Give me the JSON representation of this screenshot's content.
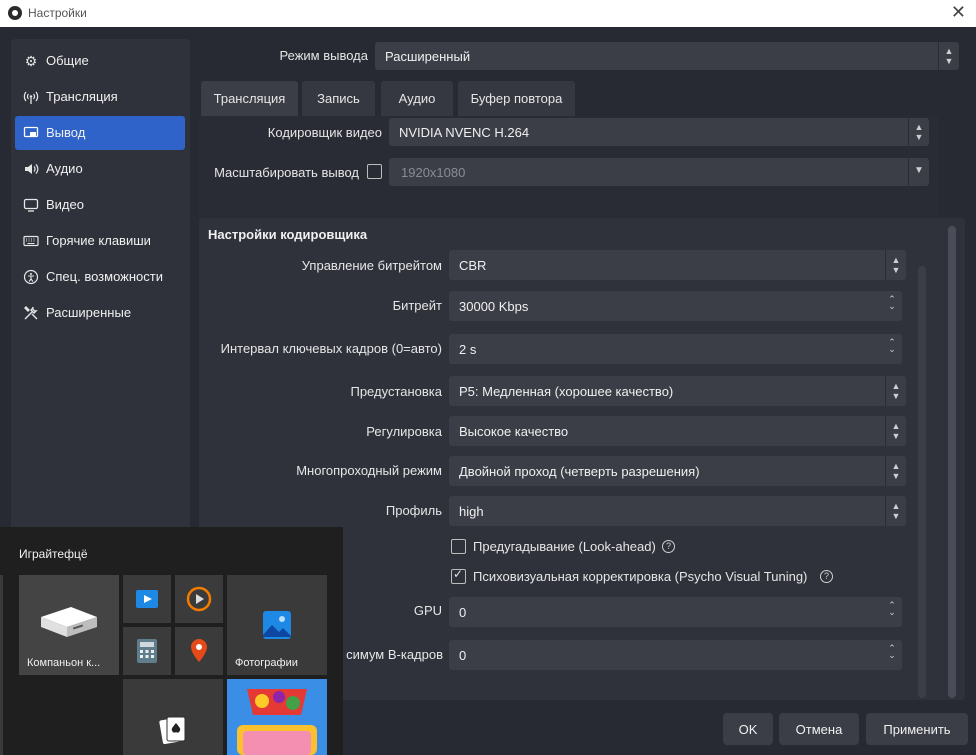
{
  "window": {
    "title": "Настройки",
    "close_glyph": "✕"
  },
  "sidebar": {
    "items": [
      {
        "label": "Общие",
        "icon": "gear-icon"
      },
      {
        "label": "Трансляция",
        "icon": "antenna-icon"
      },
      {
        "label": "Вывод",
        "icon": "output-icon"
      },
      {
        "label": "Аудио",
        "icon": "speaker-icon"
      },
      {
        "label": "Видео",
        "icon": "monitor-icon"
      },
      {
        "label": "Горячие клавиши",
        "icon": "keyboard-icon"
      },
      {
        "label": "Спец. возможности",
        "icon": "accessibility-icon"
      },
      {
        "label": "Расширенные",
        "icon": "tools-icon"
      }
    ],
    "active_index": 2
  },
  "output_mode": {
    "label": "Режим вывода",
    "value": "Расширенный"
  },
  "tabs": [
    {
      "label": "Трансляция"
    },
    {
      "label": "Запись"
    },
    {
      "label": "Аудио"
    },
    {
      "label": "Буфер повтора"
    }
  ],
  "encoder": {
    "label": "Кодировщик видео",
    "value": "NVIDIA NVENC H.264"
  },
  "rescale": {
    "label": "Масштабировать вывод",
    "value": "1920x1080",
    "checked": false
  },
  "encoder_settings": {
    "title": "Настройки кодировщика",
    "rate_control": {
      "label": "Управление битрейтом",
      "value": "CBR"
    },
    "bitrate": {
      "label": "Битрейт",
      "value": "30000 Kbps"
    },
    "keyframe": {
      "label": "Интервал ключевых кадров (0=авто)",
      "value": "2 s"
    },
    "preset": {
      "label": "Предустановка",
      "value": "P5: Медленная (хорошее качество)"
    },
    "tuning": {
      "label": "Регулировка",
      "value": "Высокое качество"
    },
    "multipass": {
      "label": "Многопроходный режим",
      "value": "Двойной проход (четверть разрешения)"
    },
    "profile": {
      "label": "Профиль",
      "value": "high"
    },
    "lookahead": {
      "label": "Предугадывание (Look-ahead)",
      "checked": false
    },
    "psycho": {
      "label": "Психовизуальная корректировка (Psycho Visual Tuning)",
      "checked": true
    },
    "gpu": {
      "label": "GPU",
      "value": "0"
    },
    "bframes": {
      "label": "симум B-кадров",
      "value": "0"
    }
  },
  "buttons": {
    "ok": "OK",
    "cancel": "Отмена",
    "apply": "Применить"
  },
  "start_menu": {
    "header": "Играйтефцё",
    "tiles": [
      {
        "label": "Компаньон к..."
      },
      {
        "label": "Фотографии"
      }
    ]
  }
}
